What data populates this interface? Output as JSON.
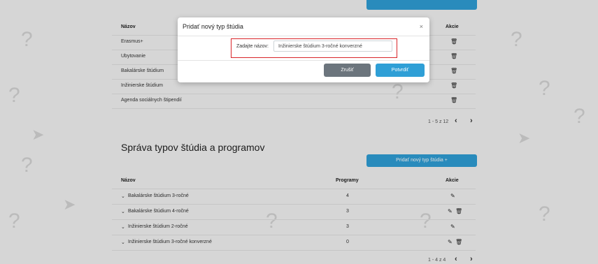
{
  "top_table": {
    "header_name": "Názov",
    "header_actions": "Akcie",
    "rows": [
      "Erasmus+",
      "Ubytovanie",
      "Bakalárske štúdium",
      "Inžinierske štúdium",
      "Agenda sociálnych štipendií"
    ],
    "pagination": "1 - 5 z 12"
  },
  "section": {
    "title": "Správa typov štúdia a programov",
    "add_button_label": "Pridať nový typ štúdia  +"
  },
  "bottom_table": {
    "header_name": "Názov",
    "header_programs": "Programy",
    "header_actions": "Akcie",
    "rows": [
      {
        "name": "Bakalárske štúdium 3-ročné",
        "programs": "4"
      },
      {
        "name": "Bakalárske štúdium 4-ročné",
        "programs": "3"
      },
      {
        "name": "Inžinierske štúdium 2-ročné",
        "programs": "3"
      },
      {
        "name": "Inžinierske štúdium 3-ročné konverzné",
        "programs": "0"
      }
    ],
    "pagination": "1 - 4 z 4"
  },
  "modal": {
    "title": "Pridať nový typ štúdia",
    "close": "×",
    "field_label": "Zadajte názov:",
    "field_value": "Inžinierske štúdium 3-ročné konverzné",
    "cancel_label": "Zrušiť",
    "confirm_label": "Potvrdiť"
  },
  "icons": {
    "trash": "trash-icon",
    "edit": "pencil-icon",
    "expand": "chevron-down-icon"
  },
  "colors": {
    "accent": "#2f9fd6",
    "highlight": "#d9252a",
    "cancel": "#6c757d"
  }
}
